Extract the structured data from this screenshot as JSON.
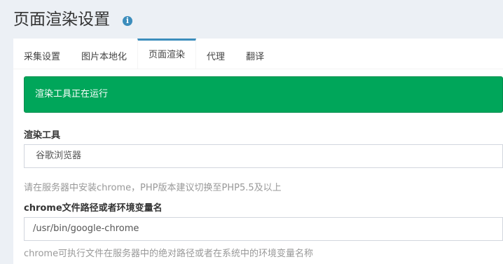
{
  "header": {
    "title": "页面渲染设置",
    "info_icon": "info-circle-icon",
    "info_glyph": "i"
  },
  "tabs": [
    {
      "label": "采集设置",
      "active": false
    },
    {
      "label": "图片本地化",
      "active": false
    },
    {
      "label": "页面渲染",
      "active": true
    },
    {
      "label": "代理",
      "active": false
    },
    {
      "label": "翻译",
      "active": false
    }
  ],
  "alert": {
    "text": "渲染工具正在运行",
    "color": "#00a65a"
  },
  "renderer": {
    "label": "渲染工具",
    "selected_value": "谷歌浏览器",
    "help": "请在服务器中安装chrome，PHP版本建议切换至PHP5.5及以上"
  },
  "chrome_path": {
    "label": "chrome文件路径或者环境变量名",
    "value": "/usr/bin/google-chrome",
    "help": "chrome可执行文件在服务器中的绝对路径或者在系统中的环境变量名称"
  },
  "colors": {
    "accent": "#3c8dbc",
    "background": "#ecf0f5"
  }
}
